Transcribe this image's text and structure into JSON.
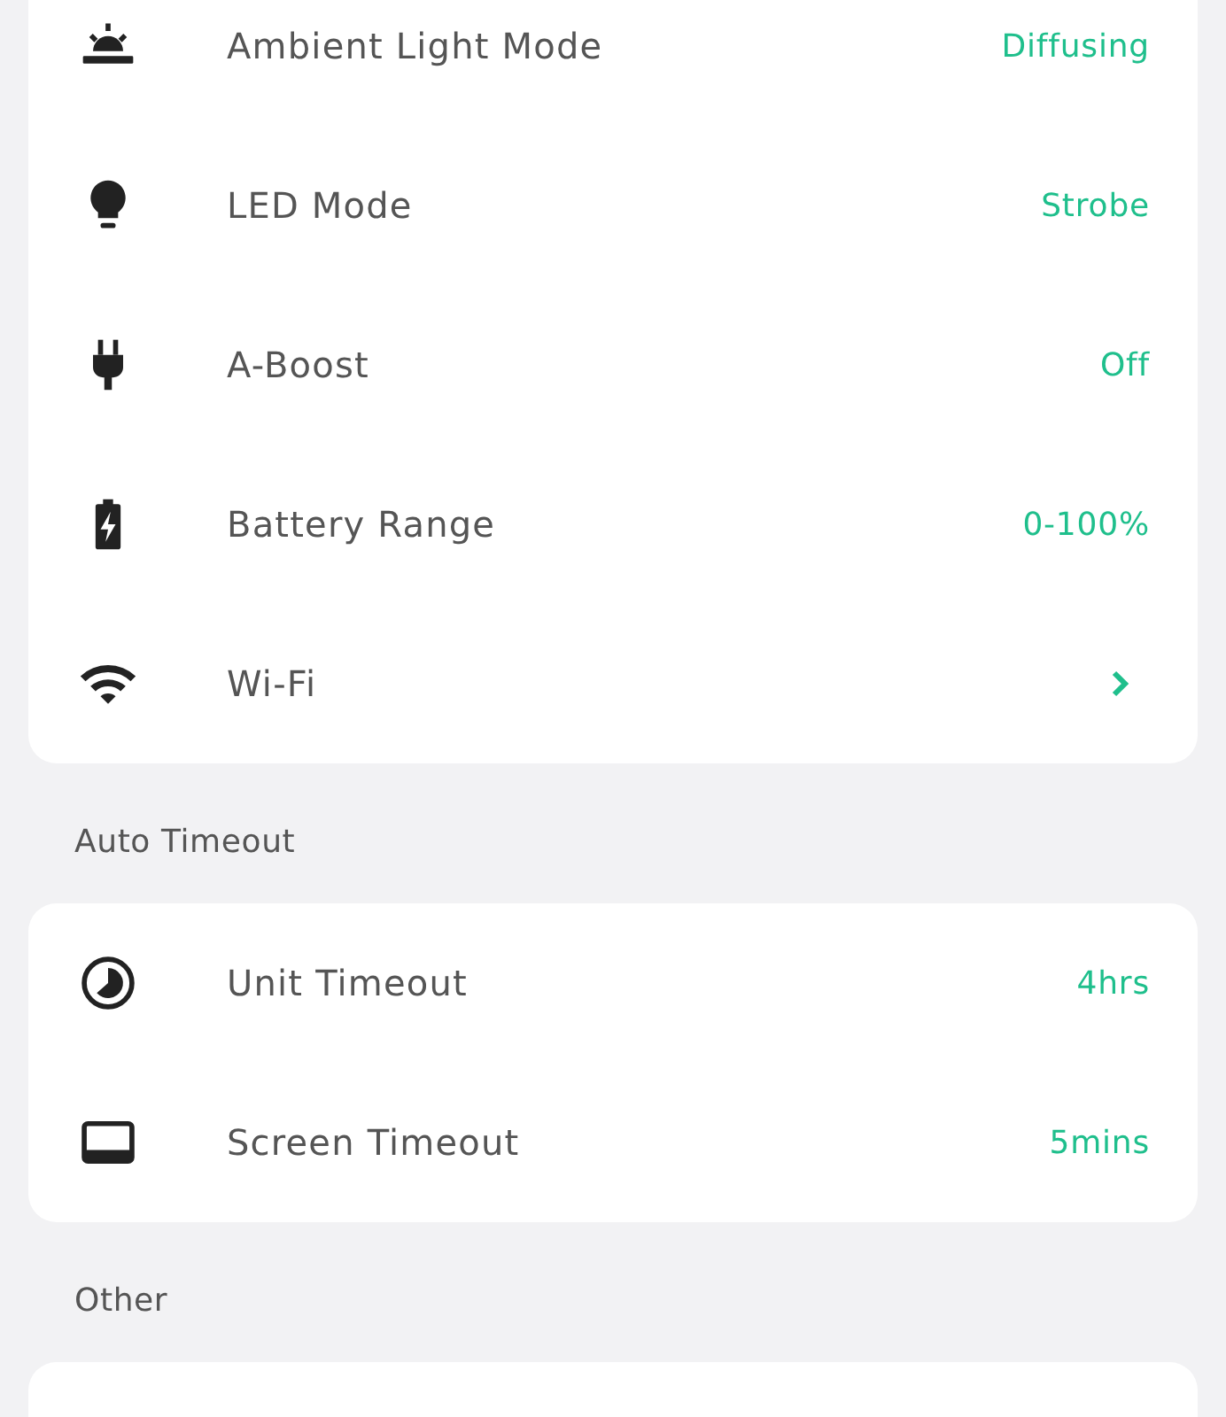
{
  "sections": [
    {
      "rows": [
        {
          "label": "Ambient Light Mode",
          "kind": "value",
          "value": "Diffusing"
        },
        {
          "label": "LED Mode",
          "kind": "value",
          "value": "Strobe"
        },
        {
          "label": "A-Boost",
          "kind": "value",
          "value": "Off"
        },
        {
          "label": "Battery Range",
          "kind": "value",
          "value": "0-100%"
        },
        {
          "label": "Wi-Fi",
          "kind": "link"
        }
      ]
    },
    {
      "title": "Auto Timeout",
      "rows": [
        {
          "label": "Unit Timeout",
          "kind": "value",
          "value": "4hrs"
        },
        {
          "label": "Screen Timeout",
          "kind": "value",
          "value": "5mins"
        }
      ]
    },
    {
      "title": "Other"
    }
  ]
}
